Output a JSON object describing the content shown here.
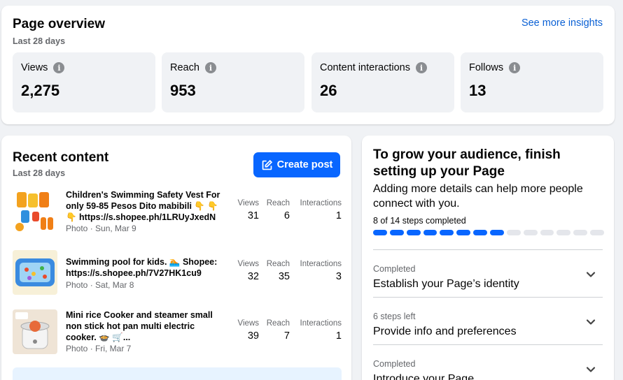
{
  "overview": {
    "title": "Page overview",
    "subtitle": "Last 28 days",
    "insights_link": "See more insights",
    "metrics": [
      {
        "label": "Views",
        "value": "2,275"
      },
      {
        "label": "Reach",
        "value": "953"
      },
      {
        "label": "Content interactions",
        "value": "26"
      },
      {
        "label": "Follows",
        "value": "13"
      }
    ]
  },
  "recent": {
    "title": "Recent content",
    "subtitle": "Last 28 days",
    "create_label": "Create post",
    "columns": [
      "Views",
      "Reach",
      "Interactions"
    ],
    "posts": [
      {
        "title": "Children's Swimming Safety Vest For only 59-85 Pesos Dito mabibili 👇 👇 👇 https://s.shopee.ph/1LRUyJxedN",
        "meta": "Photo · Sun, Mar 9",
        "views": "31",
        "reach": "6",
        "interactions": "1"
      },
      {
        "title": "Swimming pool for kids. 🏊 Shopee: https://s.shopee.ph/7V27HK1cu9",
        "meta": "Photo · Sat, Mar 8",
        "views": "32",
        "reach": "35",
        "interactions": "3"
      },
      {
        "title": "Mini rice Cooker and steamer small non stick hot pan multi electric cooker. 🍲 🛒...",
        "meta": "Photo · Fri, Mar 7",
        "views": "39",
        "reach": "7",
        "interactions": "1"
      }
    ]
  },
  "setup": {
    "title": "To grow your audience, finish setting up your Page",
    "description": "Adding more details can help more people connect with you.",
    "progress_label": "8 of 14 steps completed",
    "progress": {
      "completed": 8,
      "total": 14
    },
    "steps": [
      {
        "status": "Completed",
        "name": "Establish your Page’s identity"
      },
      {
        "status": "6 steps left",
        "name": "Provide info and preferences"
      },
      {
        "status": "Completed",
        "name": "Introduce your Page"
      }
    ]
  },
  "colors": {
    "accent": "#0866ff",
    "link": "#0a60d4",
    "muted": "#65676b",
    "surface": "#f0f2f5"
  }
}
